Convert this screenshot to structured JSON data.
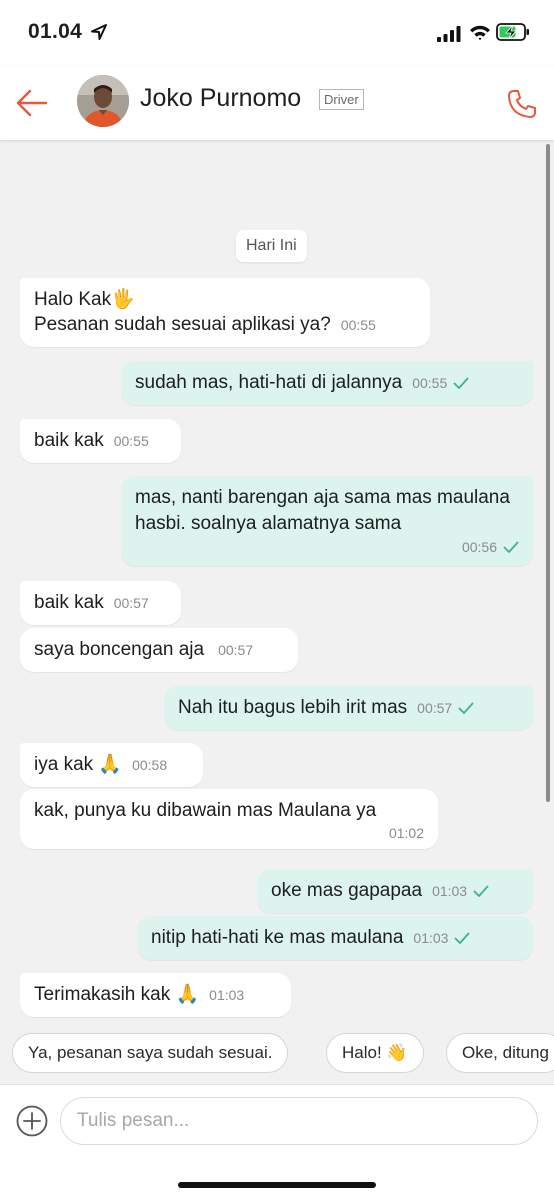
{
  "status_bar": {
    "time": "01.04",
    "icons": [
      "location-arrow-icon",
      "signal-icon",
      "wifi-icon",
      "battery-charging-icon"
    ]
  },
  "header": {
    "contact_name": "Joko Purnomo",
    "role_badge": "Driver",
    "icons": [
      "back-arrow-icon",
      "phone-icon"
    ]
  },
  "chat": {
    "date_label": "Hari Ini",
    "messages": [
      {
        "dir": "in",
        "text": "Halo Kak🖐\nPesanan sudah sesuai aplikasi ya?",
        "time": "00:55"
      },
      {
        "dir": "out",
        "text": "sudah mas, hati-hati di jalannya",
        "time": "00:55"
      },
      {
        "dir": "in",
        "text": "baik kak",
        "time": "00:55"
      },
      {
        "dir": "out",
        "text": "mas, nanti barengan aja sama mas maulana hasbi. soalnya alamatnya sama",
        "time": "00:56"
      },
      {
        "dir": "in",
        "text": "baik kak",
        "time": "00:57"
      },
      {
        "dir": "in",
        "text": "saya boncengan aja",
        "time": "00:57"
      },
      {
        "dir": "out",
        "text": "Nah itu bagus lebih irit mas",
        "time": "00:57"
      },
      {
        "dir": "in",
        "text": "iya kak 🙏",
        "time": "00:58"
      },
      {
        "dir": "in",
        "text": "kak, punya ku dibawain mas Maulana ya",
        "time": "01:02"
      },
      {
        "dir": "out",
        "text": "oke mas gapapaa",
        "time": "01:03"
      },
      {
        "dir": "out",
        "text": "nitip hati-hati ke mas maulana",
        "time": "01:03"
      },
      {
        "dir": "in",
        "text": "Terimakasih kak 🙏",
        "time": "01:03"
      }
    ]
  },
  "quick_replies": [
    "Ya, pesanan saya sudah sesuai.",
    "Halo! 👋",
    "Oke, ditung"
  ],
  "input": {
    "placeholder": "Tulis pesan..."
  },
  "colors": {
    "accent": "#e5593c",
    "outgoing_bubble": "#dcf3ee",
    "incoming_bubble": "#ffffff",
    "background": "#f1f1f1",
    "tick": "#3fae9a"
  }
}
